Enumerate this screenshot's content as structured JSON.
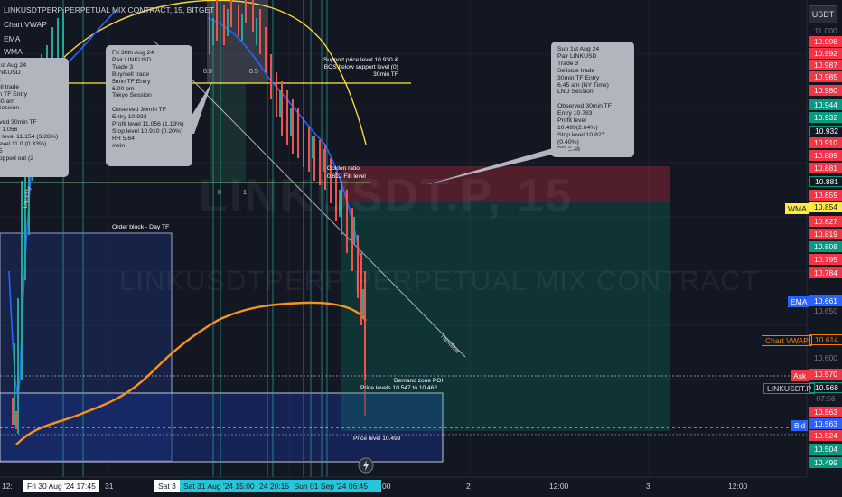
{
  "header": {
    "title": "LINKUSDTPERP PERPETUAL MIX CONTRACT, 15, BITGET",
    "legend_items": [
      "Chart VWAP",
      "EMA",
      "WMA"
    ],
    "currency_button": "USDT"
  },
  "watermark": {
    "symbol": "LINKUSDT.P, 15",
    "description": "LINKUSDTPERP PERPETUAL MIX CONTRACT"
  },
  "price_axis": {
    "labels": [
      "11.000",
      "10.998",
      "10.992",
      "10.987",
      "10.985",
      "10.980",
      "10.944",
      "10.932",
      "10.932",
      "10.910",
      "10.889",
      "10.881",
      "10.881",
      "10.859",
      "10.854",
      "10.827",
      "10.819",
      "10.808",
      "10.795",
      "10.784",
      "10.661",
      "10.650",
      "10.614",
      "10.600",
      "10.570",
      "10.568",
      "07:56",
      "10.563",
      "10.563",
      "10.524",
      "10.504",
      "10.499"
    ],
    "colors": {
      "red": "#f23645",
      "green": "#089981",
      "blue": "#2962ff",
      "orange": "#f57c00",
      "yellow": "#ffeb3b",
      "white": "#ffffff"
    }
  },
  "tags": {
    "wma": "WMA",
    "ema": "EMA",
    "vwap": "Chart VWAP",
    "ask": "Ask",
    "symbol": "LINKUSDT.P",
    "bid": "Bid"
  },
  "notes": {
    "left_partial": "1st Aug 24\nINKUSD\n3\nell trade\nin TF Entry\n30 am\nSession\n\nrved 30min TF\ny 1.056\nit level 11.154 (3.28%)\nlevel 11.0 (0.33%)\n.5\ntopped out (2",
    "fri": "Fri 30th Aug 24\nPair LINKUSD\nTrade 3\nBuy/sell trade\n5min TF Entry\n6.00 pm\nTokyo Session\n\nObserved 30min TF\nEntry 10.932\nProfit level 11.056 (1.13%)\nStop level 10.910 (0.20%)\nRR 5.64\n#win",
    "sun": "Sun 1st Aug 24\nPair LINKUSD\nTrade 3\nSellside trade\n30min TF Entry\n6.45 am (NY Time)\nLND Session\n\nObserved 30min TF\nEntry 10.783\nProfit level 10.499(2.64%)\nStop level 10.827 (0.40%)\nRR 2.46"
  },
  "labels": {
    "support": "Support price level 10.930 &\nBOS below support level (0)\n30min TF",
    "golden": "Golden ratio\n0.612  Fib level",
    "order_block": "Order block - Day TF",
    "demand_zone": "Demand zone POI",
    "price_levels": "Price levels 10.547 to 10.462",
    "price_level": "Price level 10.499",
    "trendline": "Trendline",
    "liquidity": "Liquidity",
    "fib_half_1": "0.5",
    "fib_half_2": "0.5",
    "fib_zero": "0",
    "fib_one": "1"
  },
  "time_axis": {
    "ticks": [
      "12:",
      "31",
      "2",
      "12:00",
      "3",
      "12:00"
    ],
    "highlight_left": "Fri 30 Aug '24  17:45",
    "highlight_sat": "Sat 3",
    "highlight_range": [
      "Sat 31 Aug '24  15:00",
      "24  20:15",
      "Sun 01 Sep '24  06:45"
    ],
    "right_frag": "00"
  },
  "chart_data": {
    "type": "line",
    "title": "LINKUSDTPERP PERPETUAL MIX CONTRACT, 15, BITGET",
    "series": [
      {
        "name": "Chart VWAP",
        "color": "#f57c00",
        "values": [
          10.49,
          10.5,
          10.52,
          10.54,
          10.55,
          10.57,
          10.6,
          10.63,
          10.65,
          10.66,
          10.665,
          10.661,
          10.655,
          10.614
        ]
      },
      {
        "name": "EMA",
        "color": "#2962ff",
        "values": [
          10.56,
          10.75,
          10.95,
          11.0,
          10.97,
          10.93,
          10.9,
          10.87,
          10.84,
          10.8,
          10.78,
          10.75,
          10.7
        ]
      }
    ],
    "ylim": [
      10.49,
      11.0
    ]
  }
}
